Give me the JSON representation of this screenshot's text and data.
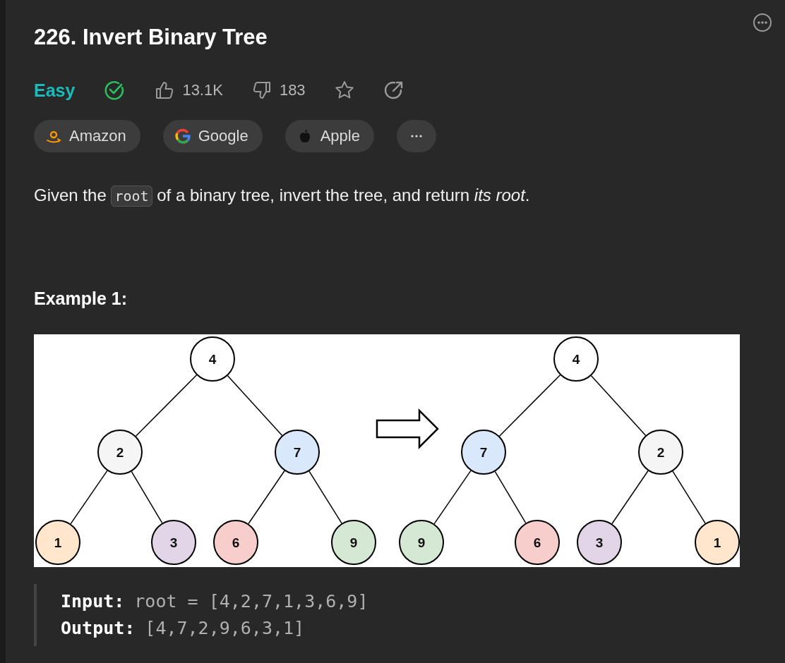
{
  "title": "226. Invert Binary Tree",
  "difficulty": {
    "label": "Easy",
    "kind": "easy"
  },
  "solved": true,
  "likes": "13.1K",
  "dislikes": "183",
  "starred": false,
  "tags": [
    {
      "label": "Amazon",
      "kind": "amazon"
    },
    {
      "label": "Google",
      "kind": "google"
    },
    {
      "label": "Apple",
      "kind": "apple"
    }
  ],
  "description": [
    {
      "kind": "text",
      "text": "Given the "
    },
    {
      "kind": "code",
      "text": "root"
    },
    {
      "kind": "text",
      "text": " of a binary tree, invert the tree, and return *its root*."
    }
  ],
  "example": {
    "title": "Example 1:",
    "trees": [
      {
        "label": "4",
        "color": "#ffffff",
        "children": [
          {
            "label": "2",
            "color": "#f5f5f5",
            "children": [
              {
                "label": "1",
                "color": "#ffe6cc"
              },
              {
                "label": "3",
                "color": "#e1d5e7"
              }
            ]
          },
          {
            "label": "7",
            "color": "#dae8fc",
            "children": [
              {
                "label": "6",
                "color": "#f8cecc"
              },
              {
                "label": "9",
                "color": "#d5e8d4"
              }
            ]
          }
        ]
      },
      {
        "label": "4",
        "color": "#ffffff",
        "children": [
          {
            "label": "7",
            "color": "#dae8fc",
            "children": [
              {
                "label": "9",
                "color": "#d5e8d4"
              },
              {
                "label": "6",
                "color": "#f8cecc"
              }
            ]
          },
          {
            "label": "2",
            "color": "#f5f5f5",
            "children": [
              {
                "label": "3",
                "color": "#e1d5e7"
              },
              {
                "label": "1",
                "color": "#ffe6cc"
              }
            ]
          }
        ]
      }
    ],
    "lines": [
      {
        "label": "Input:",
        "value": "root = [4,2,7,1,3,6,9]"
      },
      {
        "label": "Output:",
        "value": "[4,7,2,9,6,3,1]"
      }
    ]
  }
}
